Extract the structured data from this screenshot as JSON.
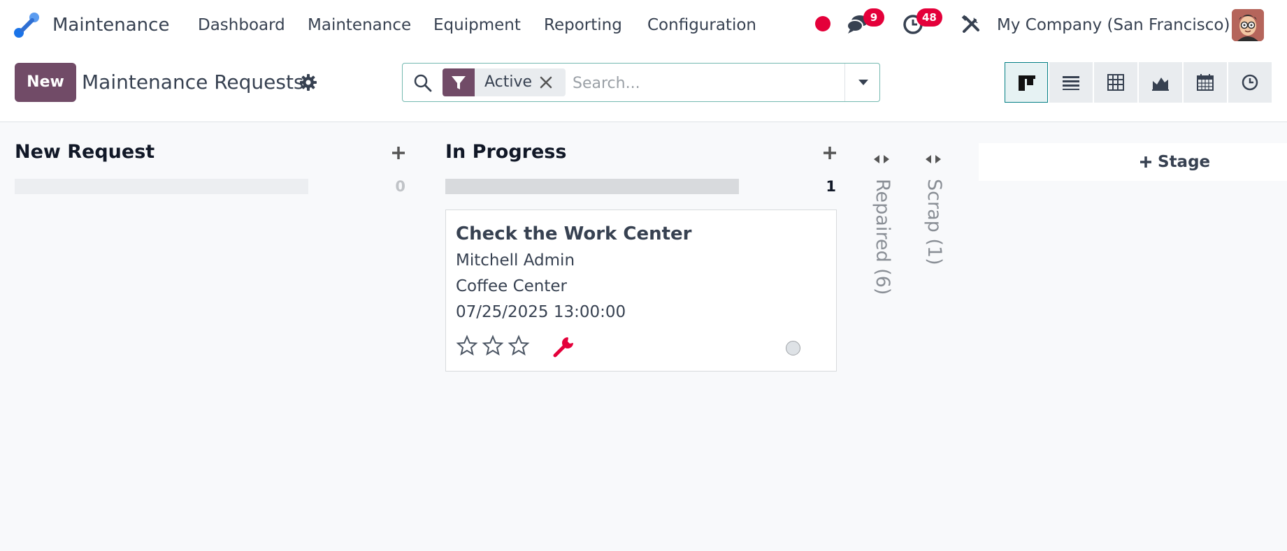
{
  "navbar": {
    "app_name": "Maintenance",
    "menus": [
      "Dashboard",
      "Maintenance",
      "Equipment",
      "Reporting",
      "Configuration"
    ],
    "messages_badge": "9",
    "activities_badge": "48",
    "company": "My Company (San Francisco)"
  },
  "control_panel": {
    "new_label": "New",
    "title": "Maintenance Requests",
    "search": {
      "facet_label": "Active",
      "placeholder": "Search..."
    },
    "views": [
      "kanban-icon",
      "list-icon",
      "pivot-icon",
      "graph-icon",
      "calendar-icon",
      "activity-icon"
    ]
  },
  "kanban": {
    "columns": [
      {
        "title": "New Request",
        "count": "0",
        "progress": 0
      },
      {
        "title": "In Progress",
        "count": "1",
        "progress": 1
      }
    ],
    "card": {
      "title": "Check the Work Center",
      "technician": "Mitchell Admin",
      "equipment": "Coffee Center",
      "date": "07/25/2025 13:00:00",
      "priority_stars": 0,
      "max_stars": 3
    },
    "folded": [
      {
        "label": "Repaired (6)"
      },
      {
        "label": "Scrap (1)"
      }
    ],
    "add_stage_label": "Stage"
  },
  "colors": {
    "brand": "#714b67",
    "accent": "#017e84",
    "badge": "#e4003a"
  }
}
